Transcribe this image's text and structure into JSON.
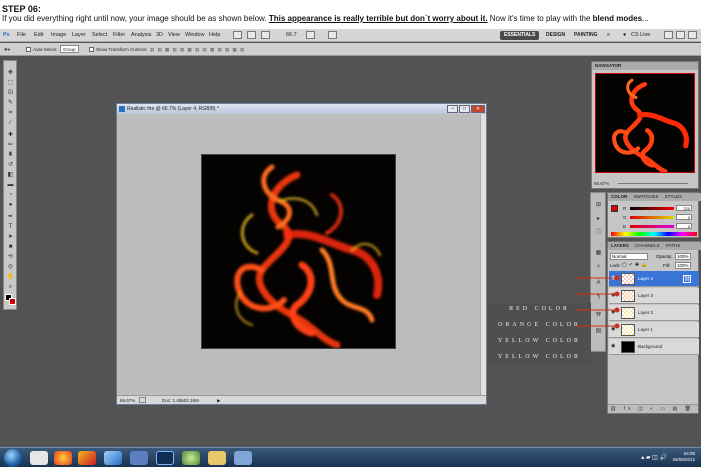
{
  "header": {
    "step": "STEP 06:",
    "line_start": "If you did everything right until now, your image should be as shown below. ",
    "line_underline": "This appearance is really terrible but don`t worry about it.",
    "line_mid": " Now it's time to play with the ",
    "line_bold": "blend modes",
    "line_end": "..."
  },
  "menubar": {
    "logo": "Ps",
    "items": [
      "File",
      "Edit",
      "Image",
      "Layer",
      "Select",
      "Filter",
      "Analysis",
      "3D",
      "View",
      "Window",
      "Help"
    ],
    "zoom": "66.7",
    "workspaces": [
      "ESSENTIALS",
      "DESIGN",
      "PAINTING",
      "»"
    ],
    "cslive": "CS Live"
  },
  "options": {
    "auto_select": "Auto-Select:",
    "auto_select_value": "Group",
    "transform": "Show Transform Controls"
  },
  "document": {
    "title": "Realistic fire @ 66.7% (Layer 4, RGB/8) *",
    "status_zoom": "66.67%",
    "status_doc": "Doc: 1.45M/2.16M"
  },
  "navigator": {
    "tab": "NAVIGATOR",
    "zoom": "66.67%"
  },
  "color_panel": {
    "tabs": [
      "COLOR",
      "SWATCHES",
      "STYLES"
    ],
    "r_label": "R",
    "g_label": "G",
    "b_label": "B",
    "r_value": "220",
    "g_value": "0",
    "b_value": "0"
  },
  "layers_panel": {
    "tabs": [
      "LAYERS",
      "CHANNELS",
      "PATHS"
    ],
    "blend_mode": "Normal",
    "opacity_label": "Opacity:",
    "opacity": "100%",
    "lock_label": "Lock:",
    "fill_label": "Fill:",
    "fill": "100%",
    "layers": [
      {
        "name": "Layer 4"
      },
      {
        "name": "Layer 3"
      },
      {
        "name": "Layer 2"
      },
      {
        "name": "Layer 1"
      },
      {
        "name": "Background"
      }
    ]
  },
  "annotations": {
    "labels": [
      "RED COLOR",
      "ORANGE COLOR",
      "YELLOW COLOR",
      "YELLOW COLOR"
    ],
    "color": "#d42a1a"
  },
  "taskbar": {
    "time": "04:05",
    "date": "28/08/2012"
  }
}
